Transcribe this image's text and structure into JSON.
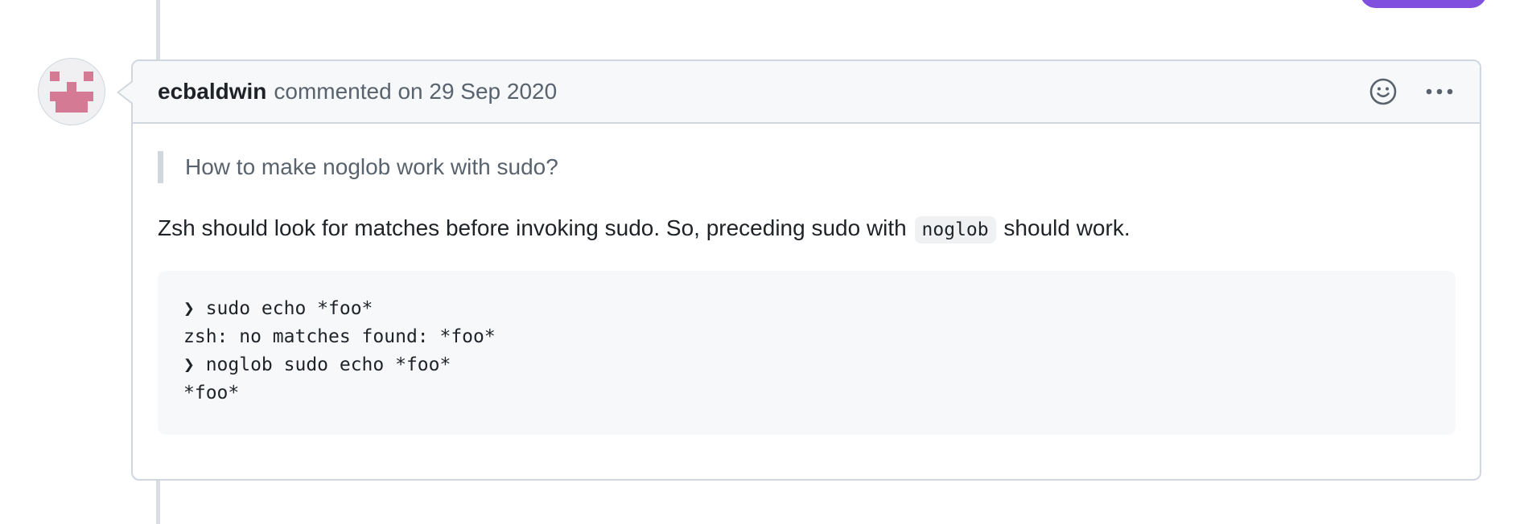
{
  "comment": {
    "author": "ecbaldwin",
    "meta": "commented on 29 Sep 2020",
    "quote": "How to make noglob work with sudo?",
    "paragraph": {
      "before": "Zsh should look for matches before invoking sudo. So, preceding sudo with ",
      "code": "noglob",
      "after": " should work."
    },
    "code_lines": [
      "❯ sudo echo *foo*",
      "zsh: no matches found: *foo*",
      "❯ noglob sudo echo *foo*",
      "*foo*"
    ]
  },
  "icons": {
    "avatar": "identicon-avatar",
    "reaction": "smiley-icon",
    "menu": "kebab-horizontal-icon"
  },
  "colors": {
    "avatar_pink": "#d47a94",
    "accent_purple": "#8250df",
    "border": "#d0d7de",
    "header_bg": "#f6f8fa"
  }
}
